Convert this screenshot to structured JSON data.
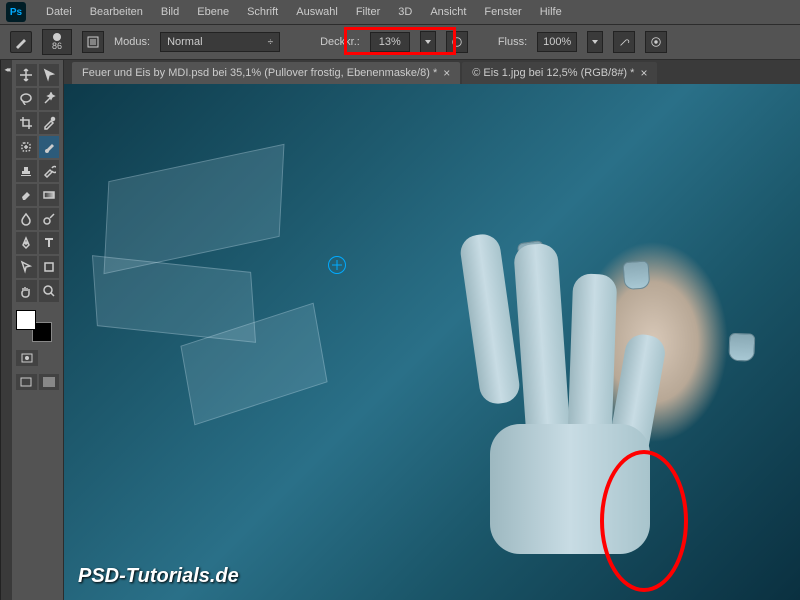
{
  "app": {
    "logo": "Ps"
  },
  "menu": {
    "items": [
      "Datei",
      "Bearbeiten",
      "Bild",
      "Ebene",
      "Schrift",
      "Auswahl",
      "Filter",
      "3D",
      "Ansicht",
      "Fenster",
      "Hilfe"
    ]
  },
  "options": {
    "brush_size": "86",
    "mode_label": "Modus:",
    "mode_value": "Normal",
    "opacity_label": "Deckkr.:",
    "opacity_value": "13%",
    "flow_label": "Fluss:",
    "flow_value": "100%"
  },
  "tabs": [
    {
      "label": "Feuer und Eis by MDI.psd bei 35,1% (Pullover frostig, Ebenenmaske/8) *",
      "close": "×",
      "active": true
    },
    {
      "label": "© Eis 1.jpg bei 12,5% (RGB/8#) *",
      "close": "×",
      "active": false
    }
  ],
  "watermark": "PSD-Tutorials.de",
  "swatch": {
    "fg": "#ffffff",
    "bg": "#000000"
  }
}
